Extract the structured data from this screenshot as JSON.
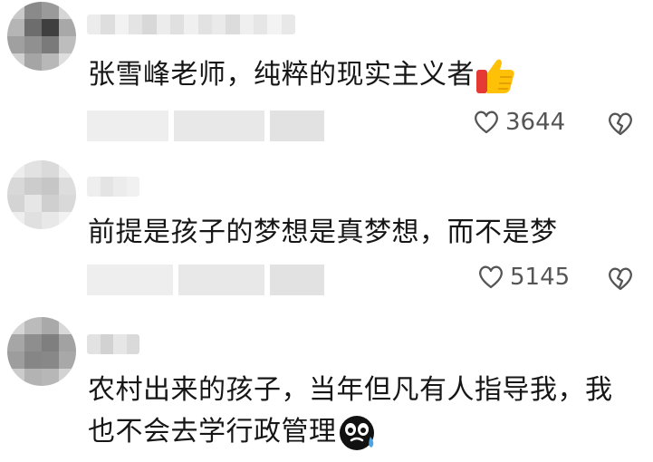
{
  "comments": [
    {
      "text": "张雪峰老师，纯粹的现实主义者",
      "emoji": "thumbs-up-emoji",
      "likes": "3644"
    },
    {
      "text": "前提是孩子的梦想是真梦想，而不是梦",
      "likes": "5145"
    },
    {
      "text_line1": "农村出来的孩子，当年但凡有人指导我，我",
      "text_line2": "也不会去学行政管理",
      "emoji": "crying-face-emoji"
    }
  ],
  "colors": {
    "text": "#161616",
    "muted": "#555555",
    "blur_light": "#eeeeee",
    "blur_mid": "#dcdcdc"
  }
}
